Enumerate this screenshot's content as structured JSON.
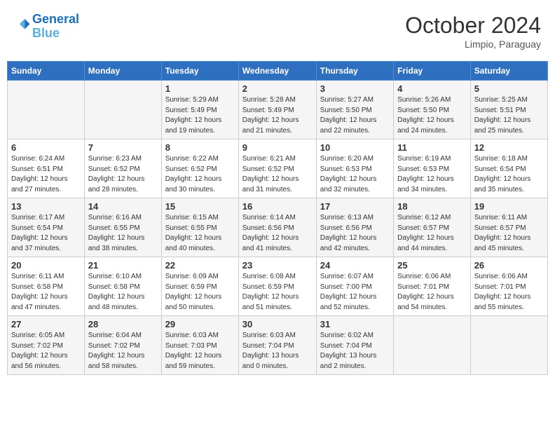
{
  "header": {
    "logo_line1": "General",
    "logo_line2": "Blue",
    "month": "October 2024",
    "location": "Limpio, Paraguay"
  },
  "days_of_week": [
    "Sunday",
    "Monday",
    "Tuesday",
    "Wednesday",
    "Thursday",
    "Friday",
    "Saturday"
  ],
  "weeks": [
    [
      {
        "day": "",
        "info": ""
      },
      {
        "day": "",
        "info": ""
      },
      {
        "day": "1",
        "info": "Sunrise: 5:29 AM\nSunset: 5:49 PM\nDaylight: 12 hours and 19 minutes."
      },
      {
        "day": "2",
        "info": "Sunrise: 5:28 AM\nSunset: 5:49 PM\nDaylight: 12 hours and 21 minutes."
      },
      {
        "day": "3",
        "info": "Sunrise: 5:27 AM\nSunset: 5:50 PM\nDaylight: 12 hours and 22 minutes."
      },
      {
        "day": "4",
        "info": "Sunrise: 5:26 AM\nSunset: 5:50 PM\nDaylight: 12 hours and 24 minutes."
      },
      {
        "day": "5",
        "info": "Sunrise: 5:25 AM\nSunset: 5:51 PM\nDaylight: 12 hours and 25 minutes."
      }
    ],
    [
      {
        "day": "6",
        "info": "Sunrise: 6:24 AM\nSunset: 6:51 PM\nDaylight: 12 hours and 27 minutes."
      },
      {
        "day": "7",
        "info": "Sunrise: 6:23 AM\nSunset: 6:52 PM\nDaylight: 12 hours and 28 minutes."
      },
      {
        "day": "8",
        "info": "Sunrise: 6:22 AM\nSunset: 6:52 PM\nDaylight: 12 hours and 30 minutes."
      },
      {
        "day": "9",
        "info": "Sunrise: 6:21 AM\nSunset: 6:52 PM\nDaylight: 12 hours and 31 minutes."
      },
      {
        "day": "10",
        "info": "Sunrise: 6:20 AM\nSunset: 6:53 PM\nDaylight: 12 hours and 32 minutes."
      },
      {
        "day": "11",
        "info": "Sunrise: 6:19 AM\nSunset: 6:53 PM\nDaylight: 12 hours and 34 minutes."
      },
      {
        "day": "12",
        "info": "Sunrise: 6:18 AM\nSunset: 6:54 PM\nDaylight: 12 hours and 35 minutes."
      }
    ],
    [
      {
        "day": "13",
        "info": "Sunrise: 6:17 AM\nSunset: 6:54 PM\nDaylight: 12 hours and 37 minutes."
      },
      {
        "day": "14",
        "info": "Sunrise: 6:16 AM\nSunset: 6:55 PM\nDaylight: 12 hours and 38 minutes."
      },
      {
        "day": "15",
        "info": "Sunrise: 6:15 AM\nSunset: 6:55 PM\nDaylight: 12 hours and 40 minutes."
      },
      {
        "day": "16",
        "info": "Sunrise: 6:14 AM\nSunset: 6:56 PM\nDaylight: 12 hours and 41 minutes."
      },
      {
        "day": "17",
        "info": "Sunrise: 6:13 AM\nSunset: 6:56 PM\nDaylight: 12 hours and 42 minutes."
      },
      {
        "day": "18",
        "info": "Sunrise: 6:12 AM\nSunset: 6:57 PM\nDaylight: 12 hours and 44 minutes."
      },
      {
        "day": "19",
        "info": "Sunrise: 6:11 AM\nSunset: 6:57 PM\nDaylight: 12 hours and 45 minutes."
      }
    ],
    [
      {
        "day": "20",
        "info": "Sunrise: 6:11 AM\nSunset: 6:58 PM\nDaylight: 12 hours and 47 minutes."
      },
      {
        "day": "21",
        "info": "Sunrise: 6:10 AM\nSunset: 6:58 PM\nDaylight: 12 hours and 48 minutes."
      },
      {
        "day": "22",
        "info": "Sunrise: 6:09 AM\nSunset: 6:59 PM\nDaylight: 12 hours and 50 minutes."
      },
      {
        "day": "23",
        "info": "Sunrise: 6:08 AM\nSunset: 6:59 PM\nDaylight: 12 hours and 51 minutes."
      },
      {
        "day": "24",
        "info": "Sunrise: 6:07 AM\nSunset: 7:00 PM\nDaylight: 12 hours and 52 minutes."
      },
      {
        "day": "25",
        "info": "Sunrise: 6:06 AM\nSunset: 7:01 PM\nDaylight: 12 hours and 54 minutes."
      },
      {
        "day": "26",
        "info": "Sunrise: 6:06 AM\nSunset: 7:01 PM\nDaylight: 12 hours and 55 minutes."
      }
    ],
    [
      {
        "day": "27",
        "info": "Sunrise: 6:05 AM\nSunset: 7:02 PM\nDaylight: 12 hours and 56 minutes."
      },
      {
        "day": "28",
        "info": "Sunrise: 6:04 AM\nSunset: 7:02 PM\nDaylight: 12 hours and 58 minutes."
      },
      {
        "day": "29",
        "info": "Sunrise: 6:03 AM\nSunset: 7:03 PM\nDaylight: 12 hours and 59 minutes."
      },
      {
        "day": "30",
        "info": "Sunrise: 6:03 AM\nSunset: 7:04 PM\nDaylight: 13 hours and 0 minutes."
      },
      {
        "day": "31",
        "info": "Sunrise: 6:02 AM\nSunset: 7:04 PM\nDaylight: 13 hours and 2 minutes."
      },
      {
        "day": "",
        "info": ""
      },
      {
        "day": "",
        "info": ""
      }
    ]
  ]
}
